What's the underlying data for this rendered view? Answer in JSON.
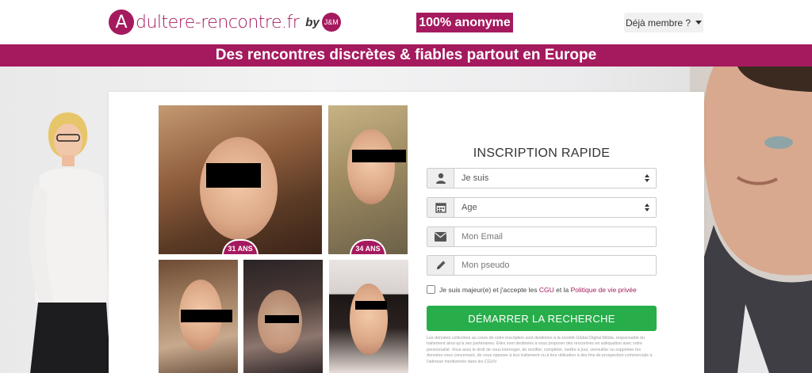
{
  "header": {
    "logo_letter": "A",
    "logo_text": "dultere-rencontre.fr",
    "logo_by": "by",
    "logo_partner": "J&M",
    "anon_badge": "100% anonyme",
    "member_button": "Déjà membre ?"
  },
  "banner": {
    "text": "Des rencontres discrètes & fiables partout en Europe"
  },
  "profiles": [
    {
      "age_label": "31 ANS"
    },
    {
      "age_label": "34 ANS"
    }
  ],
  "form": {
    "title": "INSCRIPTION RAPIDE",
    "gender_select": "Je suis",
    "age_select": "Age",
    "email_placeholder": "Mon Email",
    "pseudo_placeholder": "Mon pseudo",
    "consent_prefix": "Je suis majeur(e) et j'accepte les ",
    "consent_cgu": "CGU",
    "consent_middle": " et la ",
    "consent_privacy": "Politique de vie privée",
    "submit": "DÉMARRER LA RECHERCHE",
    "legal_text": "Les données collectées au cours de votre inscription sont destinées à la société Global Digital Média, responsable du traitement ainsi qu'à ses partenaires. Elles sont destinées à vous proposer des rencontres en adéquation avec votre personnalité. Vous avez le droit de vous interroger, de rectifier, compléter, mettre à jour, verrouiller ou supprimer les données vous concernant, de vous opposer à leur traitement ou à leur utilisation à des fins de prospection commerciale à l'adresse mentionnée dans les CGUV."
  },
  "colors": {
    "brand": "#a51a5e",
    "cta": "#27ae4a"
  },
  "icons": {
    "gender": "user-icon",
    "age": "calendar-icon",
    "email": "envelope-icon",
    "pseudo": "pencil-icon"
  }
}
